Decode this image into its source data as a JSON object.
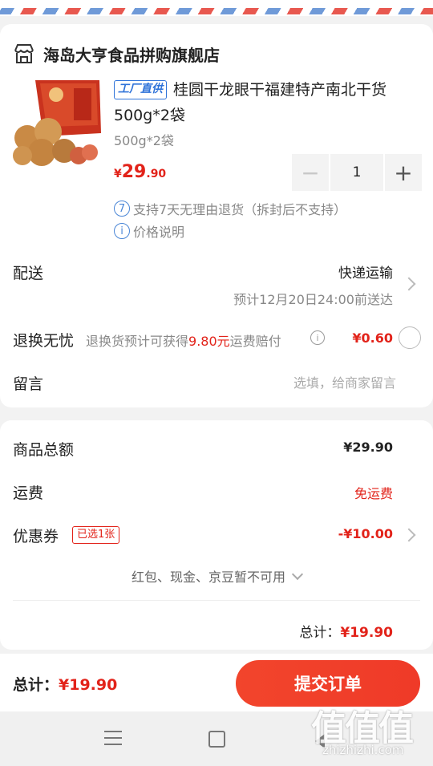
{
  "store": {
    "name": "海岛大亨食品拼购旗舰店",
    "icon": "store-icon"
  },
  "product": {
    "tag": "工厂直供",
    "title": "桂圆干龙眼干福建特产南北干货500g*2袋",
    "spec": "500g*2袋",
    "price_currency": "¥",
    "price_int": "29",
    "price_dec": ".90",
    "quantity": "1",
    "minus": "−",
    "plus": "+"
  },
  "notices": {
    "return_icon": "7",
    "return_text": "支持7天无理由退货（拆封后不支持）",
    "price_icon": "i",
    "price_text": "价格说明"
  },
  "delivery": {
    "label": "配送",
    "method": "快递运输",
    "eta": "预计12月20日24:00前送达"
  },
  "return_insurance": {
    "label": "退换无忧",
    "desc_prefix": "退换货预计可获得",
    "desc_amount": "9.80元",
    "desc_suffix": "运费赔付",
    "info_icon": "i",
    "price": "¥0.60"
  },
  "note": {
    "label": "留言",
    "placeholder": "选填，给商家留言"
  },
  "pricing": {
    "goods_label": "商品总额",
    "goods_value": "¥29.90",
    "shipping_label": "运费",
    "shipping_value": "免运费",
    "coupon_label": "优惠券",
    "coupon_badge": "已选1张",
    "coupon_value": "-¥10.00",
    "wallet_note": "红包、现金、京豆暂不可用",
    "subtotal_label": "总计：",
    "subtotal_value": "¥19.90"
  },
  "bottom": {
    "total_label": "总计：",
    "total_value": "¥19.90",
    "submit": "提交订单"
  },
  "watermark": {
    "logo": "值值值",
    "url": "zhizhizhi.com"
  },
  "colors": {
    "accent": "#e2231a",
    "tag_blue": "#2f73d9"
  }
}
